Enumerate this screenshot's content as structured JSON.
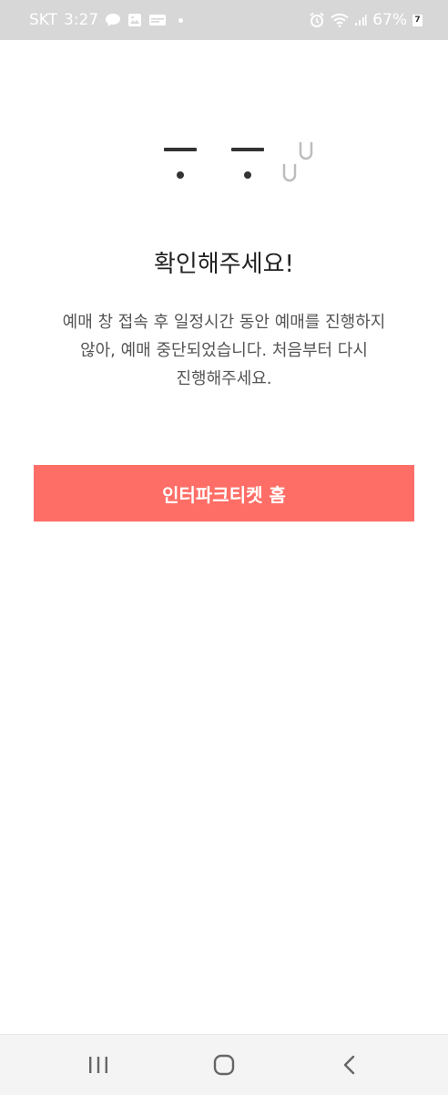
{
  "status_bar": {
    "carrier": "SKT",
    "time": "3:27",
    "battery_percent": "67%",
    "battery_badge": "7",
    "icons_left": [
      "chat-bubble-icon",
      "gallery-icon",
      "card-icon",
      "notification-dot-icon"
    ],
    "icons_right": [
      "alarm-icon",
      "wifi-icon",
      "signal-icon"
    ]
  },
  "notice": {
    "title": "확인해주세요!",
    "message_lines": [
      "예매 창 접속 후 일정시간 동안 예매를 진행하지",
      "않아, 예매 중단되었습니다. 처음부터 다시",
      "진행해주세요."
    ]
  },
  "home_button": {
    "label": "인터파크티켓 홈"
  },
  "nav_bar": {
    "buttons": [
      "recent-apps-icon",
      "home-icon",
      "back-icon"
    ]
  },
  "colors": {
    "accent": "#ff6e66",
    "status_bar_bg": "#d7d7d7",
    "title_text": "#222222",
    "body_text": "#555555"
  }
}
